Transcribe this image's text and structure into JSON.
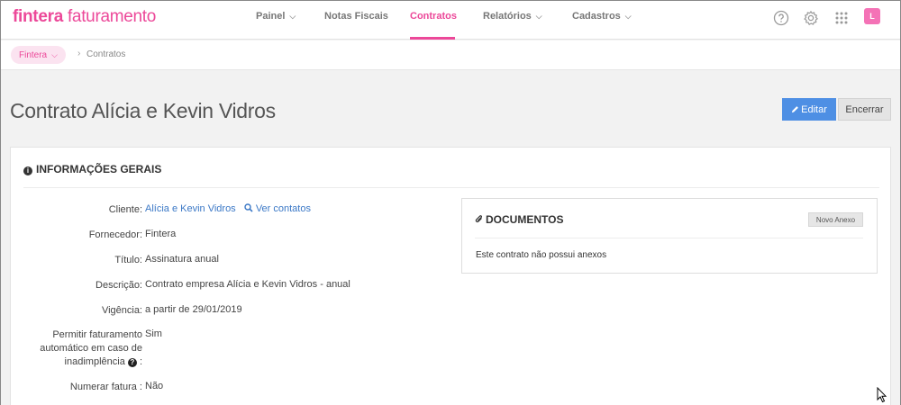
{
  "app": {
    "brand": "fintera",
    "product": "faturamento",
    "user_initial": "L"
  },
  "nav": {
    "items": [
      {
        "label": "Painel",
        "has_menu": true
      },
      {
        "label": "Notas Fiscais",
        "has_menu": false
      },
      {
        "label": "Contratos",
        "has_menu": false,
        "active": true
      },
      {
        "label": "Relatórios",
        "has_menu": true
      },
      {
        "label": "Cadastros",
        "has_menu": true
      }
    ],
    "icons": [
      "help-icon",
      "gear-icon",
      "apps-grid-icon"
    ]
  },
  "breadcrumb": {
    "org": "Fintera",
    "current": "Contratos"
  },
  "page": {
    "title": "Contrato Alícia e Kevin Vidros",
    "edit_label": "Editar",
    "close_label": "Encerrar"
  },
  "info": {
    "heading": "INFORMAÇÕES GERAIS",
    "fields": {
      "cliente_label": "Cliente:",
      "cliente_value": "Alícia e Kevin Vidros",
      "ver_contatos": "Ver contatos",
      "fornecedor_label": "Fornecedor:",
      "fornecedor_value": "Fintera",
      "titulo_label": "Título:",
      "titulo_value": "Assinatura anual",
      "descricao_label": "Descrição:",
      "descricao_value": "Contrato empresa Alícia e Kevin Vidros - anual",
      "vigencia_label": "Vigência:",
      "vigencia_value": "a partir de 29/01/2019",
      "permitir_label_1": "Permitir faturamento",
      "permitir_label_2": "automático em caso de",
      "permitir_label_3": "inadimplência",
      "permitir_label_colon": ":",
      "permitir_value": "Sim",
      "numerar_label": "Numerar fatura :",
      "numerar_value": "Não"
    }
  },
  "documents": {
    "heading": "DOCUMENTOS",
    "new_button": "Novo Anexo",
    "empty_text": "Este contrato não possui anexos"
  },
  "colors": {
    "brand": "#ec4899",
    "primary_button": "#4e8fe4",
    "link": "#3b78c6"
  }
}
